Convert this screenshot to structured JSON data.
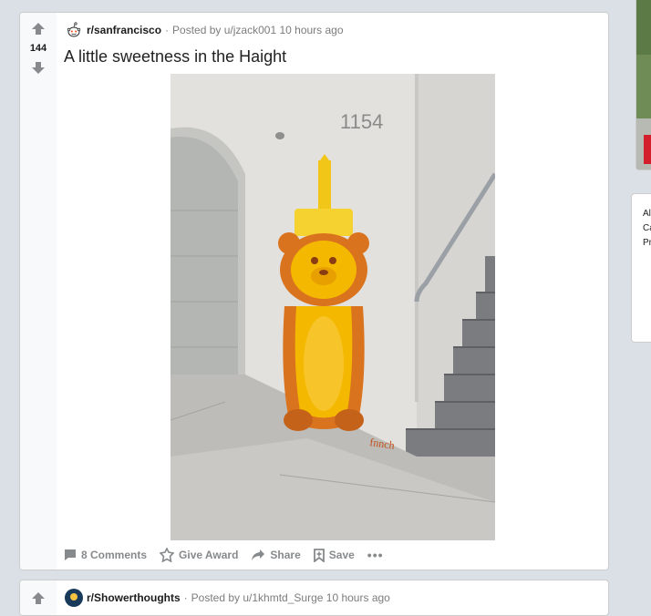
{
  "post": {
    "votes": "144",
    "subreddit": "r/sanfrancisco",
    "posted_prefix": "Posted by ",
    "username": "u/jzack001",
    "time": "10 hours ago",
    "title": "A little sweetness in the Haight",
    "image_house_number": "1154",
    "image_signature": "fnnch",
    "actions": {
      "comments": "8 Comments",
      "award": "Give Award",
      "share": "Share",
      "save": "Save",
      "more": "•••"
    }
  },
  "next_post": {
    "subreddit": "r/Showerthoughts",
    "posted_prefix": "Posted by ",
    "username": "u/1khmtd_Surge",
    "time": "10 hours ago"
  },
  "sidebar": {
    "lines": [
      "Al",
      "Ca",
      "Pr"
    ]
  },
  "colors": {
    "page_bg": "#dae0e6",
    "card_bg": "#ffffff",
    "vote_col_bg": "#f8f9fa",
    "meta_grey": "#7c7c7c",
    "action_grey": "#878a8c",
    "honey": "#f5b800",
    "bear_outline": "#d9731e"
  }
}
